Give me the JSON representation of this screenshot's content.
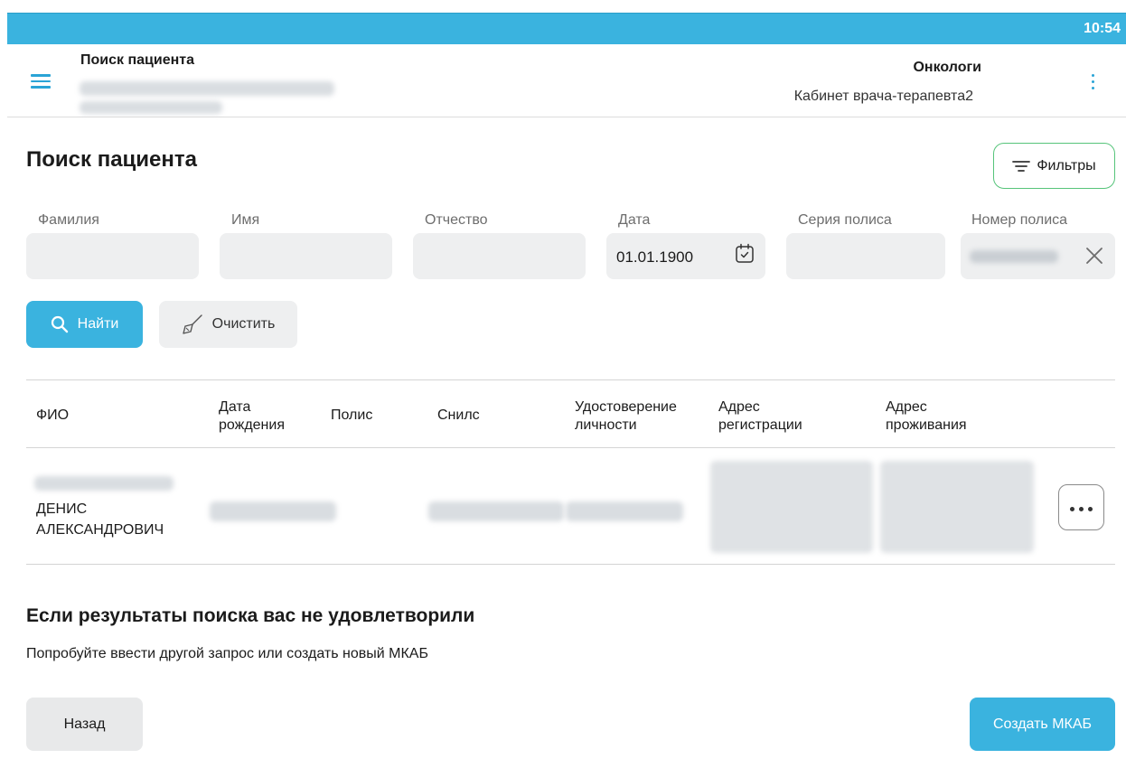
{
  "status_bar": {
    "time": "10:54"
  },
  "app_bar": {
    "title": "Поиск пациента",
    "department": "Онкологи",
    "room": "Кабинет врача-терапевта2"
  },
  "page": {
    "title": "Поиск пациента",
    "filters_label": "Фильтры"
  },
  "form": {
    "fields": [
      {
        "label": "Фамилия",
        "value": ""
      },
      {
        "label": "Имя",
        "value": ""
      },
      {
        "label": "Отчество",
        "value": ""
      },
      {
        "label": "Дата",
        "value": "01.01.1900"
      },
      {
        "label": "Серия полиса",
        "value": ""
      },
      {
        "label": "Номер полиса",
        "value": ""
      }
    ],
    "find_label": "Найти",
    "clear_label": "Очистить"
  },
  "table": {
    "columns": [
      "ФИО",
      "Дата рождения",
      "Полис",
      "Снилс",
      "Удостоверение личности",
      "Адрес регистрации",
      "Адрес проживания"
    ],
    "rows": [
      {
        "fio_first": "ДЕНИС",
        "fio_second": "АЛЕКСАНДРОВИЧ"
      }
    ]
  },
  "empty_state": {
    "heading": "Если результаты поиска вас не удовлетворили",
    "text": "Попробуйте ввести другой запрос или создать новый МКАБ"
  },
  "actions": {
    "back_label": "Назад",
    "create_label": "Создать МКАБ"
  },
  "colors": {
    "accent": "#3ab3df",
    "filters_border": "#56c47a",
    "field_bg": "#eeeff0"
  }
}
